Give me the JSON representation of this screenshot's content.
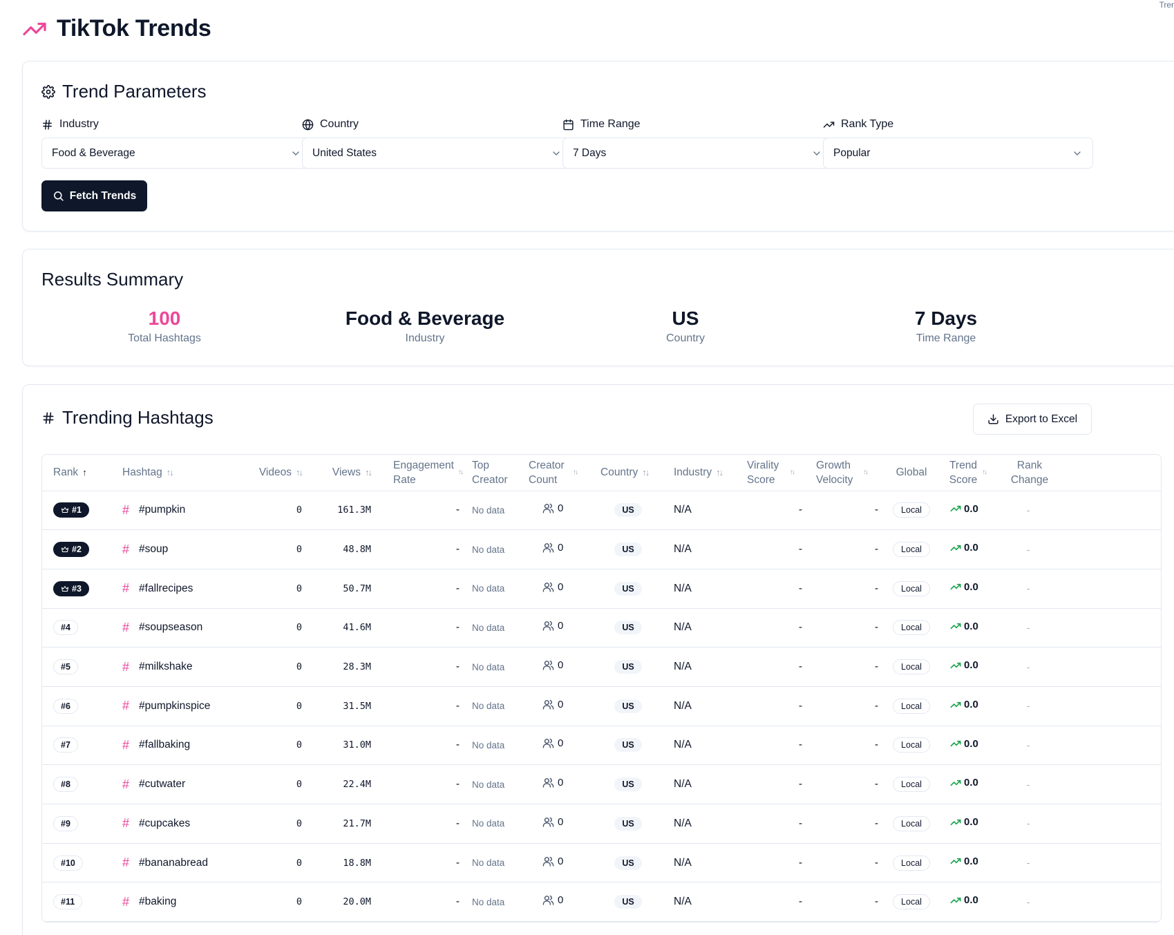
{
  "corner_text": "Trer",
  "header": {
    "title": "TikTok Trends"
  },
  "params": {
    "title": "Trend Parameters",
    "fields": [
      {
        "label": "Industry",
        "value": "Food & Beverage",
        "icon": "hash-icon"
      },
      {
        "label": "Country",
        "value": "United States",
        "icon": "globe-icon"
      },
      {
        "label": "Time Range",
        "value": "7 Days",
        "icon": "calendar-icon"
      },
      {
        "label": "Rank Type",
        "value": "Popular",
        "icon": "trending-up-icon"
      }
    ],
    "fetch_label": "Fetch Trends"
  },
  "summary": {
    "title": "Results Summary",
    "stats": [
      {
        "value": "100",
        "label": "Total Hashtags"
      },
      {
        "value": "Food & Beverage",
        "label": "Industry"
      },
      {
        "value": "US",
        "label": "Country"
      },
      {
        "value": "7 Days",
        "label": "Time Range"
      }
    ]
  },
  "table": {
    "title": "Trending Hashtags",
    "export_label": "Export to Excel",
    "columns": {
      "rank": "Rank",
      "hashtag": "Hashtag",
      "videos": "Videos",
      "views": "Views",
      "engagement": "Engagement Rate",
      "top_creator": "Top Creator",
      "creator_count": "Creator Count",
      "country": "Country",
      "industry": "Industry",
      "virality": "Virality Score",
      "growth": "Growth Velocity",
      "global": "Global",
      "trend_score": "Trend Score",
      "rank_change": "Rank Change"
    },
    "rows": [
      {
        "rank": "#1",
        "hashtag": "#pumpkin",
        "videos": "0",
        "views": "161.3M",
        "engagement": "-",
        "top_creator": "No data",
        "creators": "0",
        "country": "US",
        "industry": "N/A",
        "virality": "-",
        "growth": "-",
        "global": "Local",
        "trend": "0.0",
        "change": "-"
      },
      {
        "rank": "#2",
        "hashtag": "#soup",
        "videos": "0",
        "views": "48.8M",
        "engagement": "-",
        "top_creator": "No data",
        "creators": "0",
        "country": "US",
        "industry": "N/A",
        "virality": "-",
        "growth": "-",
        "global": "Local",
        "trend": "0.0",
        "change": "-"
      },
      {
        "rank": "#3",
        "hashtag": "#fallrecipes",
        "videos": "0",
        "views": "50.7M",
        "engagement": "-",
        "top_creator": "No data",
        "creators": "0",
        "country": "US",
        "industry": "N/A",
        "virality": "-",
        "growth": "-",
        "global": "Local",
        "trend": "0.0",
        "change": "-"
      },
      {
        "rank": "#4",
        "hashtag": "#soupseason",
        "videos": "0",
        "views": "41.6M",
        "engagement": "-",
        "top_creator": "No data",
        "creators": "0",
        "country": "US",
        "industry": "N/A",
        "virality": "-",
        "growth": "-",
        "global": "Local",
        "trend": "0.0",
        "change": "-"
      },
      {
        "rank": "#5",
        "hashtag": "#milkshake",
        "videos": "0",
        "views": "28.3M",
        "engagement": "-",
        "top_creator": "No data",
        "creators": "0",
        "country": "US",
        "industry": "N/A",
        "virality": "-",
        "growth": "-",
        "global": "Local",
        "trend": "0.0",
        "change": "-"
      },
      {
        "rank": "#6",
        "hashtag": "#pumpkinspice",
        "videos": "0",
        "views": "31.5M",
        "engagement": "-",
        "top_creator": "No data",
        "creators": "0",
        "country": "US",
        "industry": "N/A",
        "virality": "-",
        "growth": "-",
        "global": "Local",
        "trend": "0.0",
        "change": "-"
      },
      {
        "rank": "#7",
        "hashtag": "#fallbaking",
        "videos": "0",
        "views": "31.0M",
        "engagement": "-",
        "top_creator": "No data",
        "creators": "0",
        "country": "US",
        "industry": "N/A",
        "virality": "-",
        "growth": "-",
        "global": "Local",
        "trend": "0.0",
        "change": "-"
      },
      {
        "rank": "#8",
        "hashtag": "#cutwater",
        "videos": "0",
        "views": "22.4M",
        "engagement": "-",
        "top_creator": "No data",
        "creators": "0",
        "country": "US",
        "industry": "N/A",
        "virality": "-",
        "growth": "-",
        "global": "Local",
        "trend": "0.0",
        "change": "-"
      },
      {
        "rank": "#9",
        "hashtag": "#cupcakes",
        "videos": "0",
        "views": "21.7M",
        "engagement": "-",
        "top_creator": "No data",
        "creators": "0",
        "country": "US",
        "industry": "N/A",
        "virality": "-",
        "growth": "-",
        "global": "Local",
        "trend": "0.0",
        "change": "-"
      },
      {
        "rank": "#10",
        "hashtag": "#bananabread",
        "videos": "0",
        "views": "18.8M",
        "engagement": "-",
        "top_creator": "No data",
        "creators": "0",
        "country": "US",
        "industry": "N/A",
        "virality": "-",
        "growth": "-",
        "global": "Local",
        "trend": "0.0",
        "change": "-"
      },
      {
        "rank": "#11",
        "hashtag": "#baking",
        "videos": "0",
        "views": "20.0M",
        "engagement": "-",
        "top_creator": "No data",
        "creators": "0",
        "country": "US",
        "industry": "N/A",
        "virality": "-",
        "growth": "-",
        "global": "Local",
        "trend": "0.0",
        "change": "-"
      }
    ]
  },
  "colors": {
    "accent": "#ec4899",
    "primary": "#0f172a",
    "muted": "#64748b",
    "border": "#e2e8f0",
    "trend_up": "#16a34a"
  }
}
